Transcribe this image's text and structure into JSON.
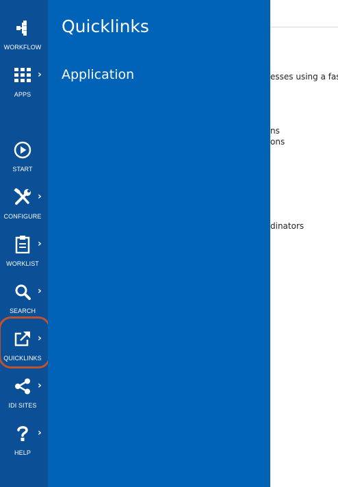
{
  "sidebar": {
    "items": [
      {
        "label": "WORKFLOW",
        "icon": "workflow-icon"
      },
      {
        "label": "APPS",
        "icon": "apps-grid-icon"
      },
      {
        "label": "START",
        "icon": "play-icon"
      },
      {
        "label": "CONFIGURE",
        "icon": "tools-icon"
      },
      {
        "label": "WORKLIST",
        "icon": "clipboard-icon"
      },
      {
        "label": "SEARCH",
        "icon": "search-icon"
      },
      {
        "label": "QUICKLINKS",
        "icon": "external-link-icon"
      },
      {
        "label": "IDI SITES",
        "icon": "share-icon"
      },
      {
        "label": "HELP",
        "icon": "help-icon"
      }
    ]
  },
  "flyout": {
    "title": "Quicklinks",
    "links": [
      {
        "label": "Application"
      }
    ]
  },
  "background": {
    "lines": [
      "esses using a fast a",
      "ns",
      "ons",
      "dinators"
    ]
  },
  "colors": {
    "nav_bg": "#0b4f96",
    "flyout_bg": "#0063b8",
    "highlight_ring": "#c0532e"
  }
}
